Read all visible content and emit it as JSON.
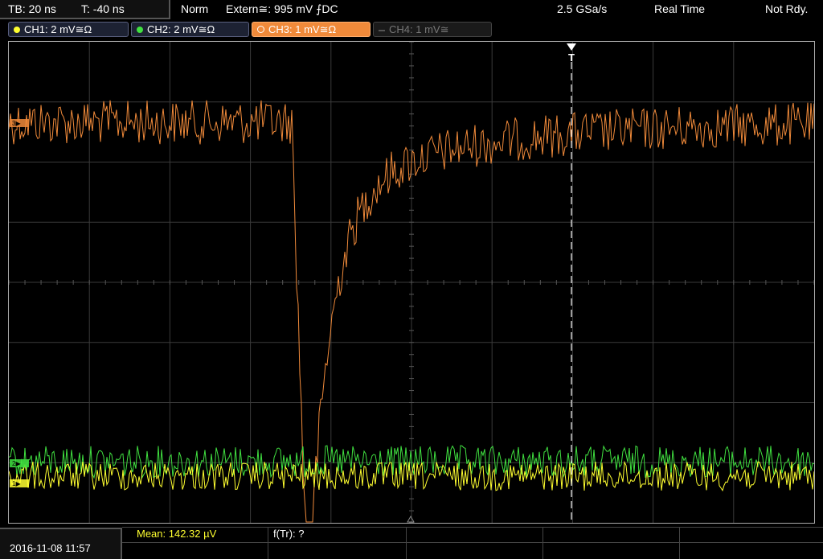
{
  "status_bar": {
    "timebase": "TB: 20 ns",
    "trigger_offset": "T: -40 ns",
    "acq_mode": "Norm",
    "trigger_source": "Extern",
    "trigger_level": "995 mV",
    "trigger_coupling": "DC",
    "sample_rate": "2.5 GSa/s",
    "mode": "Real Time",
    "state": "Not Rdy."
  },
  "channels": [
    {
      "label": "CH1: 2 mV",
      "suffix": "≅Ω",
      "color": "#ffff30",
      "active": true
    },
    {
      "label": "CH2: 2 mV",
      "suffix": "≅Ω",
      "color": "#40e040",
      "active": true
    },
    {
      "label": "CH3: 1 mV",
      "suffix": "≅Ω",
      "color": "#f08a3a",
      "active": true,
      "selected": true
    },
    {
      "label": "CH4: 1 mV",
      "suffix": "≅",
      "color": "#777777",
      "active": false
    }
  ],
  "markers": {
    "trigger": "T",
    "ch1": "1▶",
    "ch2": "2▶",
    "ch3": "3▶"
  },
  "bottom_bar": {
    "datetime": "2016-11-08 11:57",
    "measurement": "Mean: 142.32 µV",
    "measurement_color": "#ffff30",
    "measurement2": "f(Tr): ?"
  },
  "colors": {
    "grid": "#3a3a3a",
    "trace_ch1": "#ffff30",
    "trace_ch2": "#40e040",
    "trace_ch3": "#f08a3a"
  }
}
